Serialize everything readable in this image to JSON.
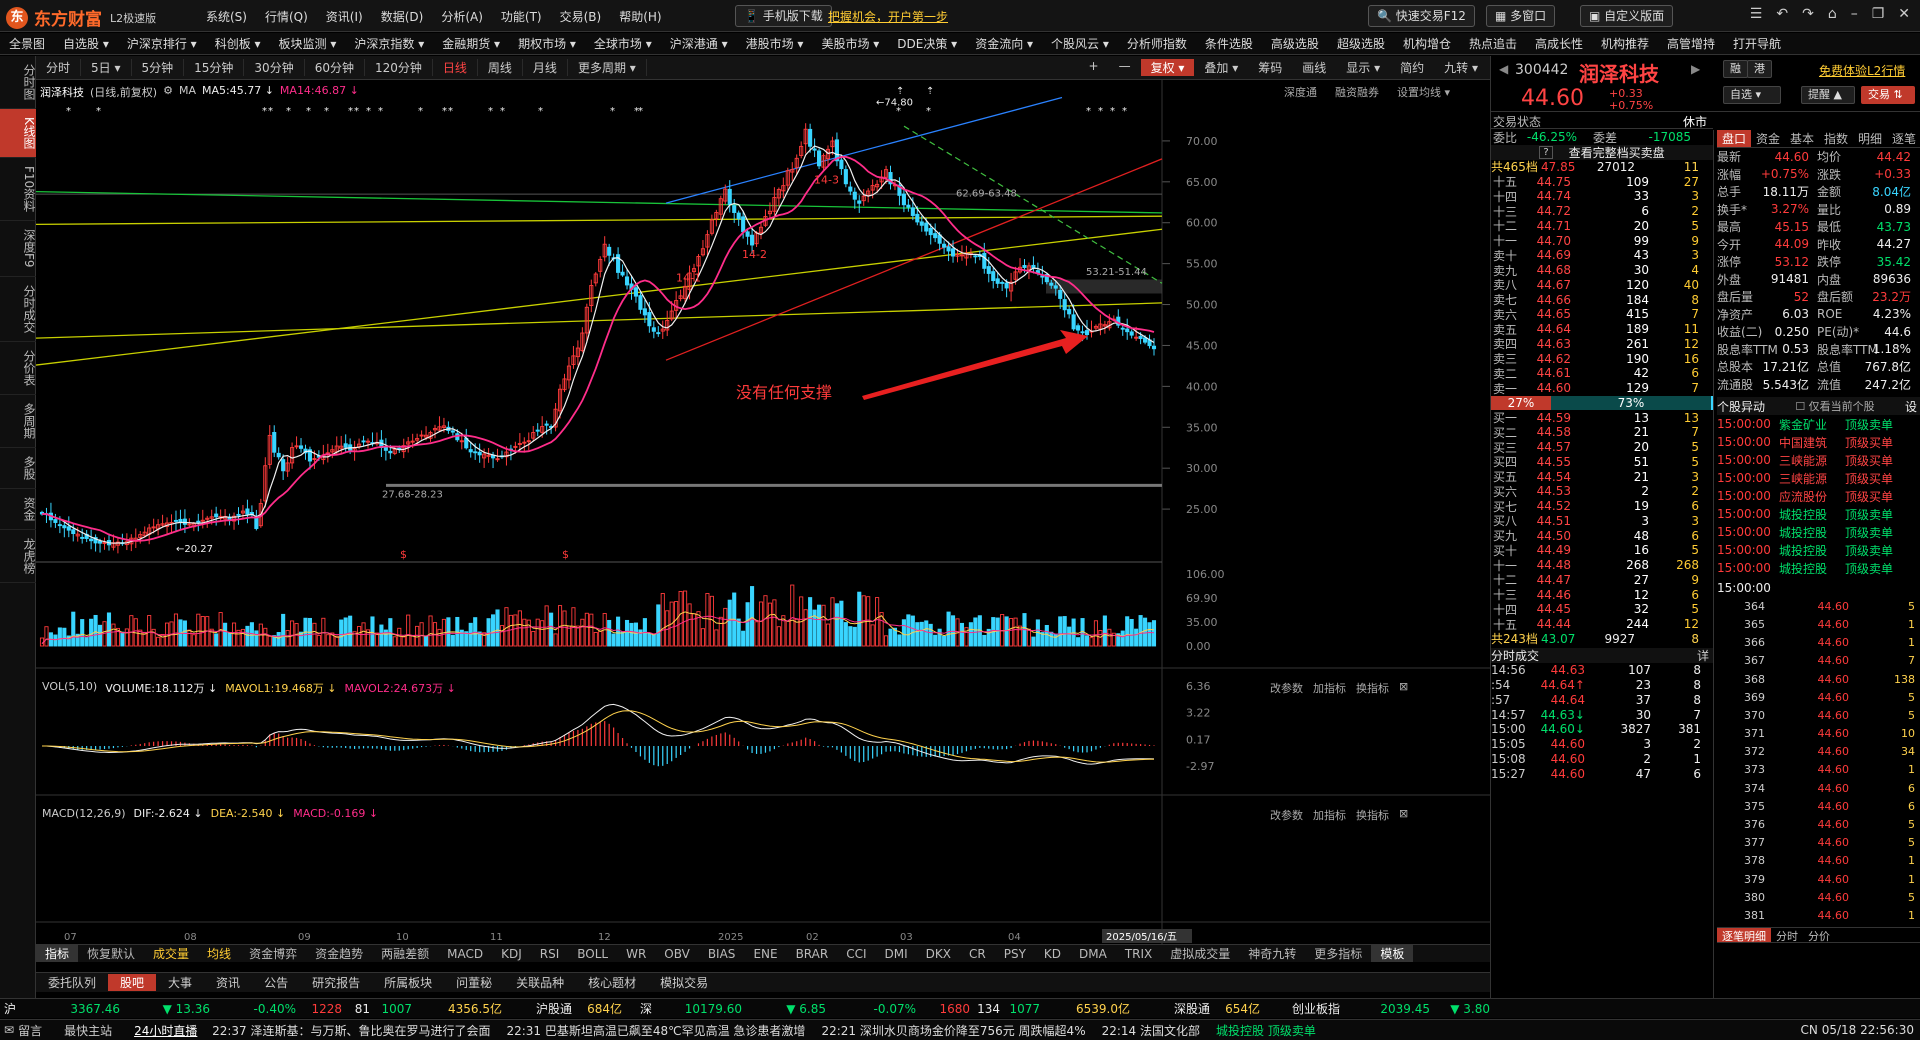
{
  "app": {
    "logo": "东方财富",
    "version": "L2极速版",
    "promo": "把握机会，开户第一步",
    "phone_btn": "手机版下载",
    "quick_trade": "快速交易F12",
    "multi_window": "多窗口",
    "custom_layout": "自定义版面",
    "menus": [
      "系统(S)",
      "行情(Q)",
      "资讯(I)",
      "数据(D)",
      "分析(A)",
      "功能(T)",
      "交易(B)",
      "帮助(H)"
    ]
  },
  "nav": [
    "全景图",
    "自选股 ▾",
    "沪深京排行 ▾",
    "科创板 ▾",
    "板块监测 ▾",
    "沪深京指数 ▾",
    "金融期货 ▾",
    "期权市场 ▾",
    "全球市场 ▾",
    "沪深港通 ▾",
    "港股市场 ▾",
    "美股市场 ▾",
    "DDE决策 ▾",
    "资金流向 ▾",
    "个股风云 ▾",
    "分析师指数",
    "条件选股",
    "高级选股",
    "超级选股",
    "机构增仓",
    "热点追击",
    "高成长性",
    "机构推荐",
    "高管增持",
    "打开导航"
  ],
  "leftbar": [
    "分时图",
    "K线图",
    "F10资料",
    "深度F9",
    "分时成交",
    "分价表",
    "多周期",
    "多股",
    "资金",
    "龙虎榜"
  ],
  "periods": [
    "分时",
    "5日 ▾",
    "5分钟",
    "15分钟",
    "30分钟",
    "60分钟",
    "120分钟",
    "日线",
    "周线",
    "月线",
    "更多周期 ▾"
  ],
  "tools": [
    "+",
    "—",
    "复权 ▾",
    "叠加 ▾",
    "筹码",
    "画线",
    "显示 ▾",
    "简约",
    "九转 ▾"
  ],
  "chart_header": {
    "name": "润泽科技",
    "mode": "(日线,前复权)",
    "ma_label": "MA",
    "ma5": "MA5:45.77 ↓",
    "ma14": "MA14:46.87 ↓",
    "links": [
      "深度通",
      "融资融券",
      "设置均线 ▾"
    ]
  },
  "volume_header": {
    "label": "VOL(5,10)",
    "volume": "VOLUME:18.112万 ↓",
    "mavol1": "MAVOL1:19.468万 ↓",
    "mavol2": "MAVOL2:24.673万 ↓",
    "links": [
      "改参数",
      "加指标",
      "换指标"
    ]
  },
  "macd_header": {
    "label": "MACD(12,26,9)",
    "dif": "DIF:-2.624 ↓",
    "dea": "DEA:-2.540 ↓",
    "macd": "MACD:-0.169 ↓",
    "links": [
      "改参数",
      "加指标",
      "换指标"
    ]
  },
  "annotation": "没有任何支撑",
  "chart_data": {
    "type": "candlestick",
    "price_axis": {
      "min": 20,
      "max": 75,
      "ticks": [
        70.0,
        65.0,
        60.0,
        55.0,
        50.0,
        45.0,
        40.0,
        35.0,
        30.0,
        25.0
      ]
    },
    "volume_axis": {
      "ticks": [
        106.0,
        69.9,
        35.0,
        0.0
      ]
    },
    "macd_axis": {
      "ticks": [
        6.36,
        3.22,
        0.17,
        -2.97
      ]
    },
    "x_ticks": [
      "07",
      "08",
      "09",
      "10",
      "11",
      "12",
      "2025",
      "02",
      "03",
      "04",
      "2025/05/16/五"
    ],
    "labels": {
      "high": "74.80",
      "low": "20.27",
      "sub1": "14-1",
      "sub2": "14-2",
      "sub3": "14-3",
      "rng1": "27.68-28.23",
      "rng2": "53.21-51.44",
      "rng3": "62.69-63.48"
    },
    "close_path": [
      24.6,
      23.5,
      22.3,
      21.5,
      21.0,
      20.6,
      20.9,
      21.6,
      22.7,
      23.4,
      23.6,
      23.1,
      23.8,
      24.2,
      23.9,
      24.6,
      24.1,
      33.4,
      29.9,
      33.1,
      30.9,
      31.4,
      32.7,
      32.2,
      33.3,
      33.1,
      31.8,
      32.9,
      33.7,
      34.4,
      35.3,
      33.7,
      32.0,
      31.7,
      31.1,
      32.3,
      33.1,
      34.6,
      35.9,
      41.2,
      45.0,
      52.6,
      57.3,
      54.1,
      51.6,
      48.4,
      46.3,
      48.8,
      52.4,
      55.3,
      60.1,
      63.8,
      60.2,
      57.4,
      60.3,
      63.7,
      66.9,
      71.1,
      67.3,
      69.4,
      64.9,
      62.1,
      64.4,
      66.1,
      63.4,
      60.9,
      59.0,
      57.4,
      55.9,
      56.3,
      55.6,
      52.9,
      52.2,
      54.5,
      54.6,
      52.9,
      51.4,
      47.2,
      46.4,
      47.6,
      48.0,
      46.7,
      45.8,
      44.6
    ]
  },
  "quote": {
    "code": "300442",
    "name": "润泽科技",
    "price": "44.60",
    "change": "+0.33",
    "change_pct": "+0.75%",
    "badges": [
      "融",
      "港"
    ],
    "free_l2": "免费体验L2行情",
    "buttons": [
      "自选 ▾",
      "提醒 ▲",
      "交易 ⇅"
    ]
  },
  "orderbook": {
    "status": "交易状态",
    "status_val": "休市",
    "ratio_label": "委比",
    "ratio": "-46.25%",
    "diff_label": "委差",
    "diff": "-17085",
    "complete": "查看完整档买卖盘",
    "ask_total": {
      "label": "共465档",
      "price": "47.85",
      "vol": "27012",
      "n": "11"
    },
    "asks": [
      [
        "十五",
        "44.75",
        "109",
        "27"
      ],
      [
        "十四",
        "44.74",
        "33",
        "3"
      ],
      [
        "十三",
        "44.72",
        "6",
        "2"
      ],
      [
        "十二",
        "44.71",
        "20",
        "5"
      ],
      [
        "十一",
        "44.70",
        "99",
        "9"
      ],
      [
        "卖十",
        "44.69",
        "43",
        "3"
      ],
      [
        "卖九",
        "44.68",
        "30",
        "4"
      ],
      [
        "卖八",
        "44.67",
        "120",
        "40"
      ],
      [
        "卖七",
        "44.66",
        "184",
        "8"
      ],
      [
        "卖六",
        "44.65",
        "415",
        "7"
      ],
      [
        "卖五",
        "44.64",
        "189",
        "11"
      ],
      [
        "卖四",
        "44.63",
        "261",
        "12"
      ],
      [
        "卖三",
        "44.62",
        "190",
        "16"
      ],
      [
        "卖二",
        "44.61",
        "42",
        "6"
      ],
      [
        "卖一",
        "44.60",
        "129",
        "7"
      ]
    ],
    "ratio_bar": {
      "left": "27%",
      "right": "73%"
    },
    "bids": [
      [
        "买一",
        "44.59",
        "13",
        "13"
      ],
      [
        "买二",
        "44.58",
        "21",
        "7"
      ],
      [
        "买三",
        "44.57",
        "20",
        "5"
      ],
      [
        "买四",
        "44.55",
        "51",
        "5"
      ],
      [
        "买五",
        "44.54",
        "21",
        "3"
      ],
      [
        "买六",
        "44.53",
        "2",
        "2"
      ],
      [
        "买七",
        "44.52",
        "19",
        "6"
      ],
      [
        "买八",
        "44.51",
        "3",
        "3"
      ],
      [
        "买九",
        "44.50",
        "48",
        "6"
      ],
      [
        "买十",
        "44.49",
        "16",
        "5"
      ],
      [
        "十一",
        "44.48",
        "268",
        "268"
      ],
      [
        "十二",
        "44.47",
        "27",
        "9"
      ],
      [
        "十三",
        "44.46",
        "12",
        "6"
      ],
      [
        "十四",
        "44.45",
        "32",
        "5"
      ],
      [
        "十五",
        "44.44",
        "244",
        "12"
      ]
    ],
    "bid_total": {
      "label": "共243档",
      "price": "43.07",
      "vol": "9927",
      "n": "8"
    }
  },
  "trades": {
    "title": "分时成交",
    "detail": "详",
    "rows": [
      [
        "14:56",
        "44.63",
        "107",
        "8"
      ],
      [
        ":54",
        "44.64↑",
        "23",
        "8"
      ],
      [
        ":57",
        "44.64",
        "37",
        "8"
      ],
      [
        "14:57",
        "44.63↓",
        "30",
        "7"
      ],
      [
        "15:00",
        "44.60↓",
        "3827",
        "381"
      ],
      [
        "15:05",
        "44.60",
        "3",
        "2"
      ],
      [
        "15:08",
        "44.60",
        "2",
        "1"
      ],
      [
        "15:27",
        "44.60",
        "47",
        "6"
      ]
    ]
  },
  "quote_panel": {
    "tabs": [
      "盘口",
      "资金",
      "基本",
      "指数",
      "明细",
      "逐笔"
    ],
    "rows": [
      [
        "最新",
        "44.60",
        "均价",
        "44.42"
      ],
      [
        "涨幅",
        "+0.75%",
        "涨跌",
        "+0.33"
      ],
      [
        "总手",
        "18.11万",
        "金额",
        "8.04亿"
      ],
      [
        "换手*",
        "3.27%",
        "量比",
        "0.89"
      ],
      [
        "最高",
        "45.15",
        "最低",
        "43.73"
      ],
      [
        "今开",
        "44.09",
        "昨收",
        "44.27"
      ],
      [
        "涨停",
        "53.12",
        "跌停",
        "35.42"
      ],
      [
        "外盘",
        "91481",
        "内盘",
        "89636"
      ],
      [
        "盘后量",
        "52",
        "盘后额",
        "23.2万"
      ],
      [
        "净资产",
        "6.03",
        "ROE",
        "4.23%"
      ],
      [
        "收益(二)",
        "0.250",
        "PE(动)*",
        "44.6"
      ],
      [
        "股息率TTM",
        "0.53",
        "股息率TTM",
        "1.18%"
      ],
      [
        "总股本",
        "17.21亿",
        "总值",
        "767.8亿"
      ],
      [
        "流通股",
        "5.543亿",
        "流值",
        "247.2亿"
      ]
    ]
  },
  "alerts": {
    "title": "个股异动",
    "option": "仅看当前个股",
    "settings": "设",
    "rows": [
      [
        "15:00:00",
        "紫金矿业",
        "顶级卖单"
      ],
      [
        "15:00:00",
        "中国建筑",
        "顶级买单"
      ],
      [
        "15:00:00",
        "三峡能源",
        "顶级买单"
      ],
      [
        "15:00:00",
        "三峡能源",
        "顶级买单"
      ],
      [
        "15:00:00",
        "应流股份",
        "顶级买单"
      ],
      [
        "15:00:00",
        "城投控股",
        "顶级卖单"
      ],
      [
        "15:00:00",
        "城投控股",
        "顶级卖单"
      ],
      [
        "15:00:00",
        "城投控股",
        "顶级卖单"
      ],
      [
        "15:00:00",
        "城投控股",
        "顶级卖单"
      ]
    ]
  },
  "ticks": {
    "time": "15:00:00",
    "rows": [
      [
        "364",
        "44.60",
        "5"
      ],
      [
        "365",
        "44.60",
        "1"
      ],
      [
        "366",
        "44.60",
        "1"
      ],
      [
        "367",
        "44.60",
        "7"
      ],
      [
        "368",
        "44.60",
        "138"
      ],
      [
        "369",
        "44.60",
        "5"
      ],
      [
        "370",
        "44.60",
        "5"
      ],
      [
        "371",
        "44.60",
        "10"
      ],
      [
        "372",
        "44.60",
        "34"
      ],
      [
        "373",
        "44.60",
        "1"
      ],
      [
        "374",
        "44.60",
        "6"
      ],
      [
        "375",
        "44.60",
        "6"
      ],
      [
        "376",
        "44.60",
        "5"
      ],
      [
        "377",
        "44.60",
        "5"
      ],
      [
        "378",
        "44.60",
        "1"
      ],
      [
        "379",
        "44.60",
        "1"
      ],
      [
        "380",
        "44.60",
        "5"
      ],
      [
        "381",
        "44.60",
        "1"
      ]
    ],
    "bottom_tabs": [
      "逐笔明细",
      "分时",
      "分价"
    ]
  },
  "indicators": [
    "指标",
    "恢复默认",
    "成交量",
    "均线",
    "资金博弈",
    "资金趋势",
    "两融差额",
    "MACD",
    "KDJ",
    "RSI",
    "BOLL",
    "WR",
    "OBV",
    "BIAS",
    "ENE",
    "BRAR",
    "CCI",
    "DMI",
    "DKX",
    "CR",
    "PSY",
    "KD",
    "DMA",
    "TRIX",
    "虚拟成交量",
    "神奇九转",
    "更多指标",
    "模板"
  ],
  "news_tabs": [
    "委托队列",
    "股吧",
    "大事",
    "资讯",
    "公告",
    "研究报告",
    "所属板块",
    "问董秘",
    "关联品种",
    "核心题材",
    "模拟交易"
  ],
  "status": {
    "sh": "沪",
    "sh_val": "3367.46",
    "sh_chg": "▼ 13.36",
    "sh_pct": "-0.40%",
    "sh_n": "1228",
    "sh_n2": "81",
    "sh_n3": "1007",
    "sh_amt": "4356.5亿",
    "hgt": "沪股通",
    "hgt_val": "684亿",
    "sz": "深",
    "sz_val": "10179.60",
    "sz_chg": "▼ 6.85",
    "sz_pct": "-0.07%",
    "sz_n": "1680",
    "sz_n2": "134",
    "sz_n3": "1077",
    "sz_amt": "6539.0亿",
    "sgt": "深股通",
    "sgt_val": "654亿",
    "cyb": "创业板指",
    "cyb_val": "2039.45",
    "cyb_chg": "▼ 3.80"
  },
  "ticker": {
    "left": "留言",
    "mail": "最快主站",
    "live": "24小时直播",
    "news": [
      "22:37  泽连斯基：与万斯、鲁比奥在罗马进行了会面",
      "22:31  巴基斯坦高温已飙至48℃罕见高温 急诊患者激增",
      "22:21  深圳水贝商场金价降至756元 周跌幅超4%",
      "22:14  法国文化部"
    ],
    "alert": "城投控股 顶级卖单",
    "clock": "CN 05/18 22:56:30"
  }
}
